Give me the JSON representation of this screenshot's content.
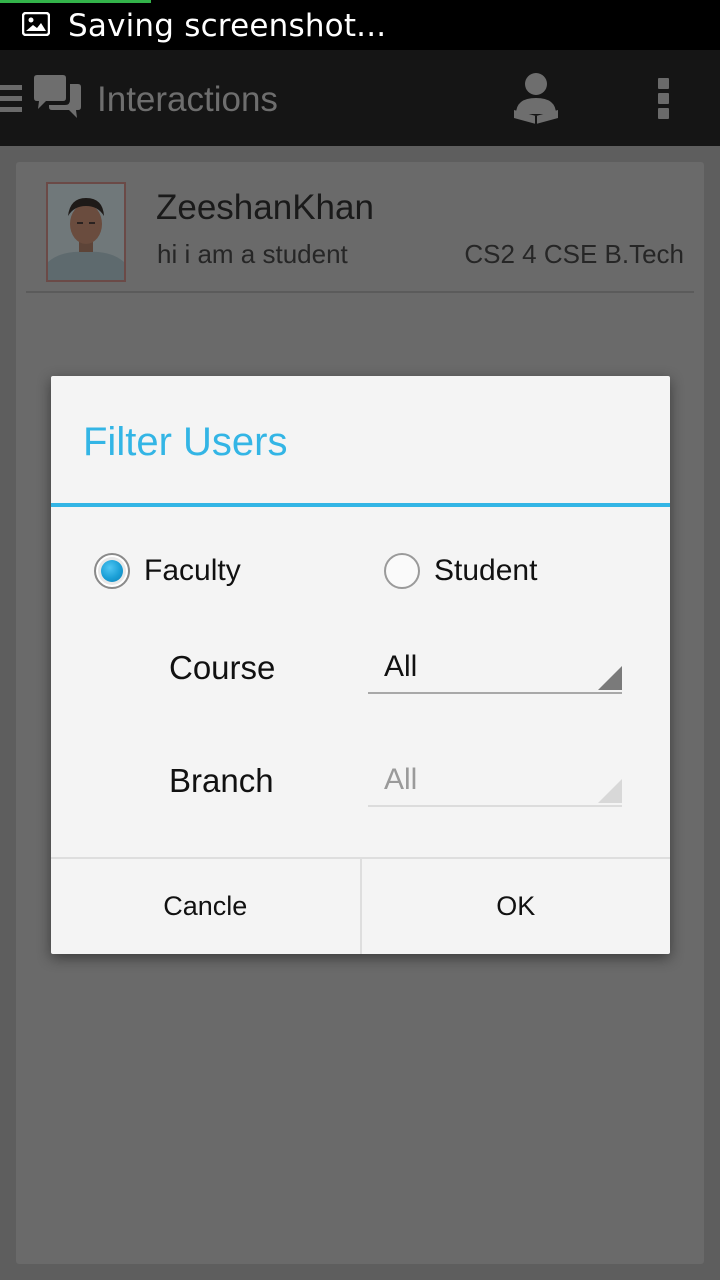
{
  "status_bar": {
    "notification_text": "Saving screenshot...",
    "icon": "image-icon"
  },
  "action_bar": {
    "title": "Interactions",
    "nav_icon": "drawer-icon",
    "app_icon": "chat-bubbles-icon",
    "profile_icon": "user-profile-icon",
    "menu_icon": "overflow-menu-icon"
  },
  "user": {
    "name": "ZeeshanKhan",
    "status": "hi i am a student",
    "class_info": "CS2 4 CSE B.Tech"
  },
  "dialog": {
    "title": "Filter Users",
    "radios": [
      {
        "label": "Faculty",
        "checked": true
      },
      {
        "label": "Student",
        "checked": false
      }
    ],
    "course": {
      "label": "Course",
      "value": "All"
    },
    "branch": {
      "label": "Branch",
      "value": "All",
      "enabled": false
    },
    "cancel_label": "Cancle",
    "ok_label": "OK"
  },
  "colors": {
    "accent": "#33b5e5",
    "overlay": "#5e5e5e",
    "dialog_bg": "#f4f4f4"
  }
}
